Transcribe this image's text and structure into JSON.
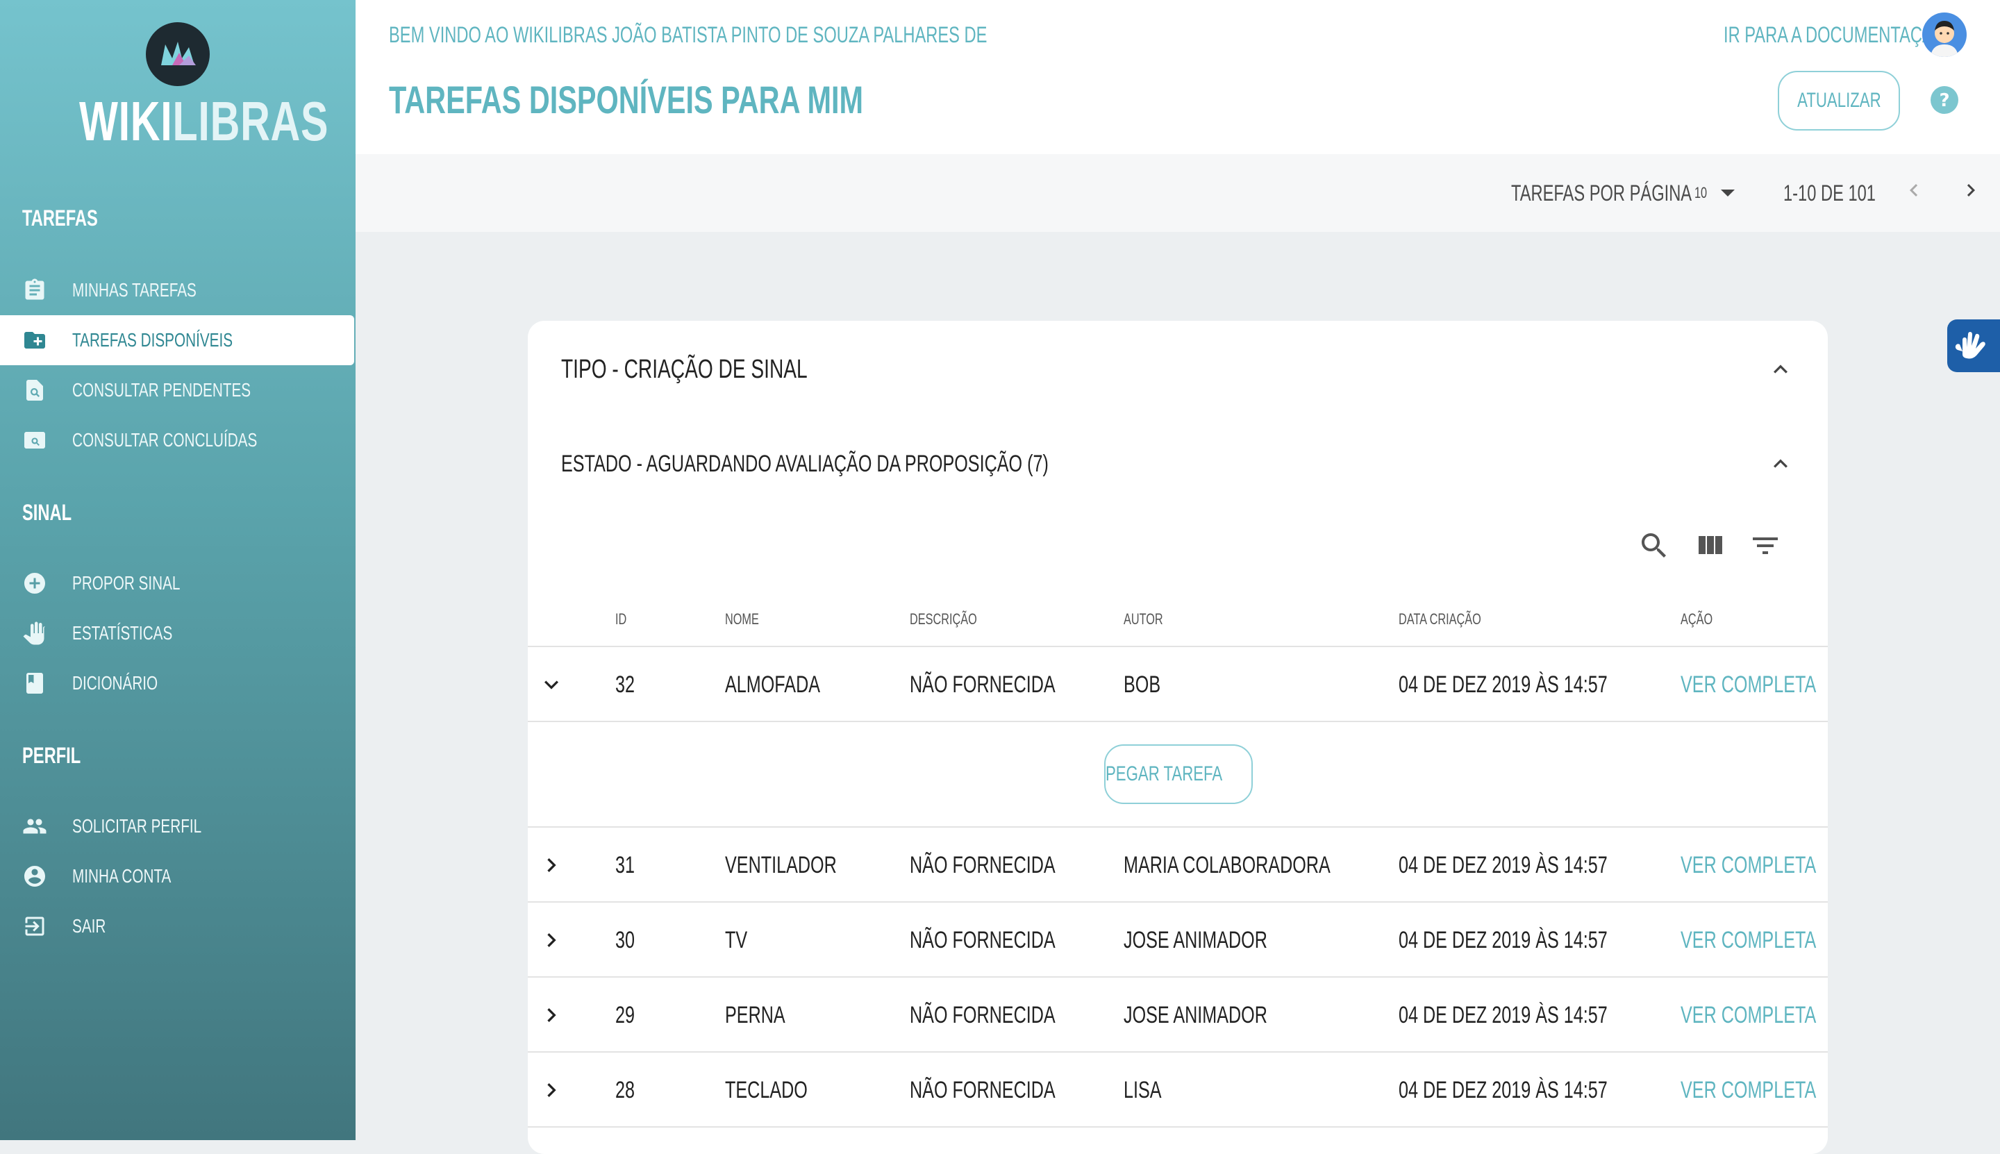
{
  "app": {
    "logo_bold": "WIKI",
    "logo_light": "LIBRAS"
  },
  "sidebar": {
    "sections": [
      {
        "title": "TAREFAS",
        "items": [
          {
            "label": "MINHAS TAREFAS",
            "icon": "clipboard-icon"
          },
          {
            "label": "TAREFAS DISPONÍVEIS",
            "icon": "folder-plus-icon",
            "active": true
          },
          {
            "label": "CONSULTAR PENDENTES",
            "icon": "search-document-icon"
          },
          {
            "label": "CONSULTAR CONCLUÍDAS",
            "icon": "image-search-icon"
          }
        ]
      },
      {
        "title": "SINAL",
        "items": [
          {
            "label": "PROPOR SINAL",
            "icon": "plus-circle-icon"
          },
          {
            "label": "ESTATÍSTICAS",
            "icon": "hand-icon"
          },
          {
            "label": "DICIONÁRIO",
            "icon": "book-icon"
          }
        ]
      },
      {
        "title": "PERFIL",
        "items": [
          {
            "label": "SOLICITAR PERFIL",
            "icon": "people-icon"
          },
          {
            "label": "MINHA CONTA",
            "icon": "account-circle-icon"
          },
          {
            "label": "SAIR",
            "icon": "exit-icon"
          }
        ]
      }
    ]
  },
  "header": {
    "welcome": "BEM VINDO AO WIKILIBRAS JOÃO BATISTA PINTO DE SOUZA PALHARES DE",
    "title": "TAREFAS DISPONÍVEIS PARA MIM",
    "docs_link": "IR PARA A DOCUMENTAÇÃO",
    "refresh_label": "ATUALIZAR"
  },
  "pagination": {
    "per_page_label": "TAREFAS POR PÁGINA",
    "per_page_value": "10",
    "range": "1-10 DE 101"
  },
  "card": {
    "type_title": "TIPO - CRIAÇÃO DE SINAL",
    "state_title": "ESTADO - AGUARDANDO AVALIAÇÃO DA PROPOSIÇÃO (7)",
    "columns": [
      "ID",
      "NOME",
      "DESCRIÇÃO",
      "AUTOR",
      "DATA CRIAÇÃO",
      "AÇÃO"
    ],
    "take_task_label": "PEGAR TAREFA",
    "rows": [
      {
        "id": "32",
        "name": "ALMOFADA",
        "description": "NÃO FORNECIDA",
        "author": "BOB",
        "date": "04 DE DEZ 2019 ÀS 14:57",
        "action": "VER COMPLETA",
        "expanded": true
      },
      {
        "id": "31",
        "name": "VENTILADOR",
        "description": "NÃO FORNECIDA",
        "author": "MARIA COLABORADORA",
        "date": "04 DE DEZ 2019 ÀS 14:57",
        "action": "VER COMPLETA"
      },
      {
        "id": "30",
        "name": "TV",
        "description": "NÃO FORNECIDA",
        "author": "JOSE ANIMADOR",
        "date": "04 DE DEZ 2019 ÀS 14:57",
        "action": "VER COMPLETA"
      },
      {
        "id": "29",
        "name": "PERNA",
        "description": "NÃO FORNECIDA",
        "author": "JOSE ANIMADOR",
        "date": "04 DE DEZ 2019 ÀS 14:57",
        "action": "VER COMPLETA"
      },
      {
        "id": "28",
        "name": "TECLADO",
        "description": "NÃO FORNECIDA",
        "author": "LISA",
        "date": "04 DE DEZ 2019 ÀS 14:57",
        "action": "VER COMPLETA"
      }
    ]
  },
  "colors": {
    "accent": "#5fb5c0",
    "sidebar_top": "#75c3cd",
    "sidebar_bottom": "#41767e",
    "a11y": "#1e5fa8"
  }
}
